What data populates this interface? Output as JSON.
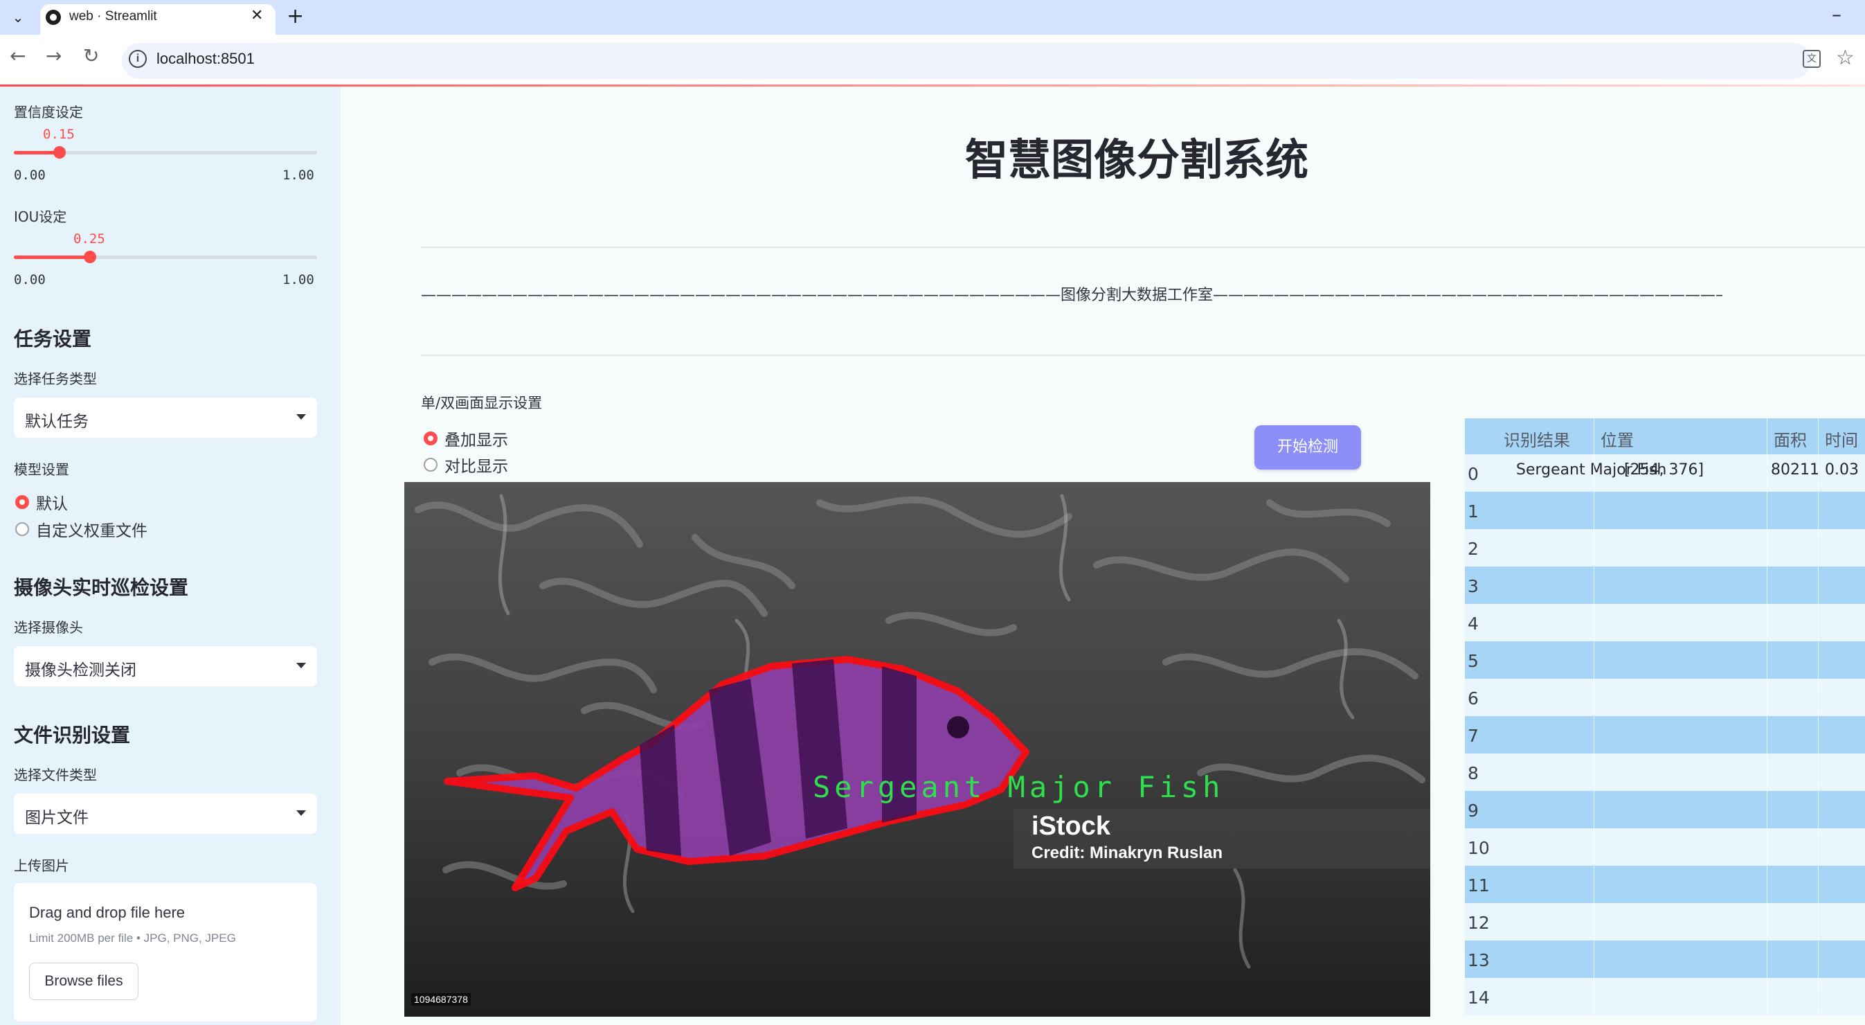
{
  "browser": {
    "tab_title": "web · Streamlit",
    "url": "localhost:8501"
  },
  "sidebar": {
    "confidence_label": "置信度设定",
    "confidence_value": "0.15",
    "confidence_fraction": 0.15,
    "confidence_min": "0.00",
    "confidence_max": "1.00",
    "iou_label": "IOU设定",
    "iou_value": "0.25",
    "iou_fraction": 0.25,
    "iou_min": "0.00",
    "iou_max": "1.00",
    "task_header": "任务设置",
    "task_type_label": "选择任务类型",
    "task_type_value": "默认任务",
    "model_label": "模型设置",
    "model_options": [
      "默认",
      "自定义权重文件"
    ],
    "model_selected": 0,
    "camera_header": "摄像头实时巡检设置",
    "camera_label": "选择摄像头",
    "camera_value": "摄像头检测关闭",
    "file_header": "文件识别设置",
    "file_type_label": "选择文件类型",
    "file_type_value": "图片文件",
    "upload_label": "上传图片",
    "upload_title": "Drag and drop file here",
    "upload_limit": "Limit 200MB per file • JPG, PNG, JPEG",
    "browse_label": "Browse files"
  },
  "main": {
    "title": "智慧图像分割系统",
    "divider_text": "——————————————————————————————————————————图像分割大数据工作室——————————————————————————————————————————",
    "display_label": "单/双画面显示设置",
    "display_options": [
      "叠加显示",
      "对比显示"
    ],
    "display_selected": 0,
    "detect_button": "开始检测"
  },
  "image": {
    "detection_label": "Sergeant Major Fish",
    "watermark_brand": "iStock",
    "watermark_credit": "Credit: Minakryn Ruslan",
    "image_id": "1094687378",
    "mask_color": "#8e3fa8",
    "outline_color": "#ff0a14",
    "label_color": "#2ee04e"
  },
  "table": {
    "headers": [
      "识别结果",
      "位置",
      "面积",
      "时间"
    ],
    "rows": [
      {
        "idx": "0",
        "result": "Sergeant Major Fish",
        "position": "[254, 376]",
        "area": "80211",
        "time": "0.03"
      },
      {
        "idx": "1"
      },
      {
        "idx": "2"
      },
      {
        "idx": "3"
      },
      {
        "idx": "4"
      },
      {
        "idx": "5"
      },
      {
        "idx": "6"
      },
      {
        "idx": "7"
      },
      {
        "idx": "8"
      },
      {
        "idx": "9"
      },
      {
        "idx": "10"
      },
      {
        "idx": "11"
      },
      {
        "idx": "12"
      },
      {
        "idx": "13"
      },
      {
        "idx": "14"
      }
    ]
  }
}
